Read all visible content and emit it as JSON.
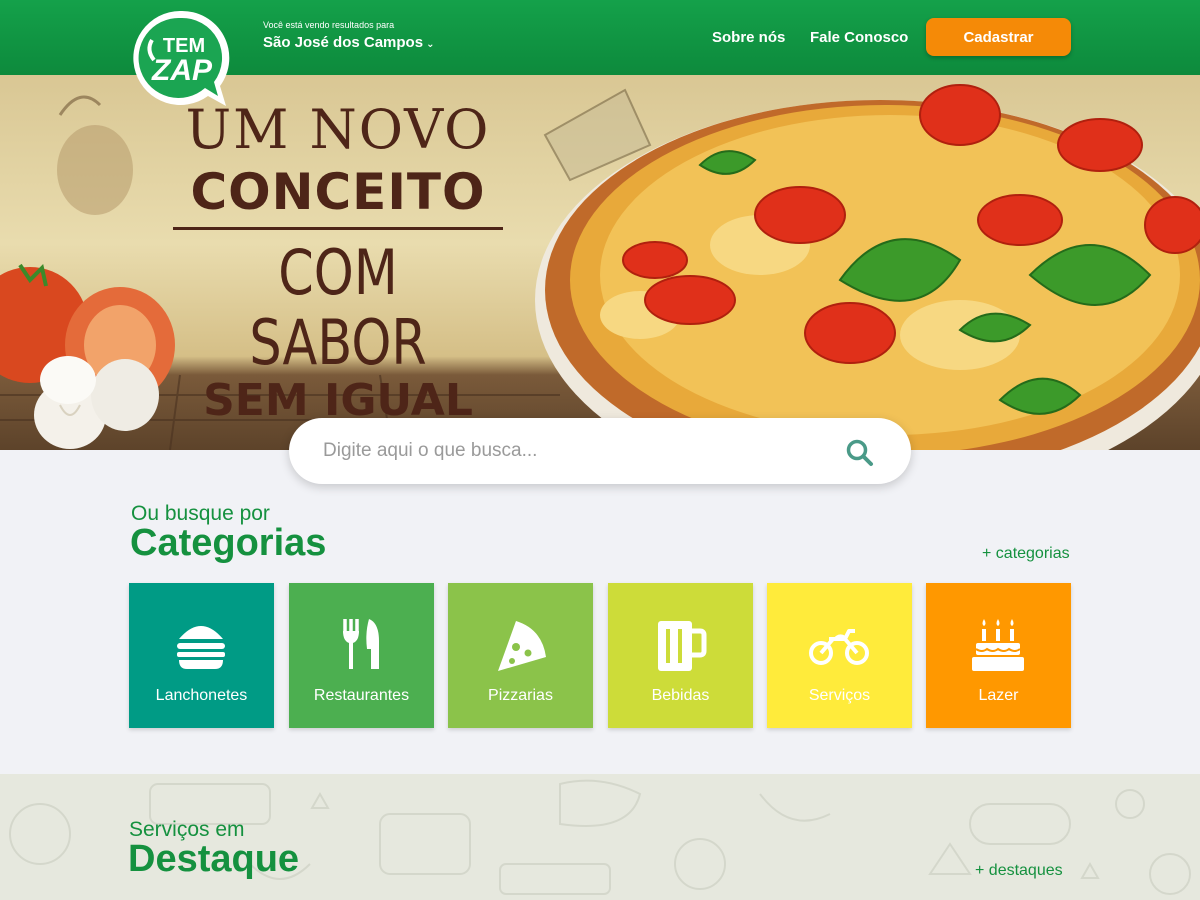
{
  "header": {
    "logo_text_top": "TEM",
    "logo_text_bottom": "ZAP",
    "location_label": "Você está vendo resultados para",
    "location_city": "São José dos Campos",
    "nav": [
      {
        "label": "Sobre nós"
      },
      {
        "label": "Fale Conosco"
      }
    ],
    "cta_label": "Cadastrar"
  },
  "hero": {
    "line1": "UM NOVO",
    "line2": "CONCEITO",
    "line3": "COM SABOR",
    "line4": "SEM IGUAL"
  },
  "search": {
    "placeholder": "Digite aqui o que busca...",
    "icon": "search-icon"
  },
  "categories": {
    "subtitle": "Ou busque por",
    "title": "Categorias",
    "more_label": "+ categorias",
    "items": [
      {
        "label": "Lanchonetes",
        "icon": "burger-icon",
        "color": "#009b85"
      },
      {
        "label": "Restaurantes",
        "icon": "fork-knife-icon",
        "color": "#4caf50"
      },
      {
        "label": "Pizzarias",
        "icon": "pizza-icon",
        "color": "#8bc34a"
      },
      {
        "label": "Bebidas",
        "icon": "beer-mug-icon",
        "color": "#cddc39"
      },
      {
        "label": "Serviços",
        "icon": "motorcycle-icon",
        "color": "#ffeb3b"
      },
      {
        "label": "Lazer",
        "icon": "cake-icon",
        "color": "#ff9800"
      }
    ]
  },
  "highlights": {
    "subtitle": "Serviços em",
    "title": "Destaque",
    "more_label": "+ destaques"
  },
  "colors": {
    "brand_green": "#14a14a",
    "accent_orange": "#f58a07",
    "text_green": "#15913f"
  }
}
